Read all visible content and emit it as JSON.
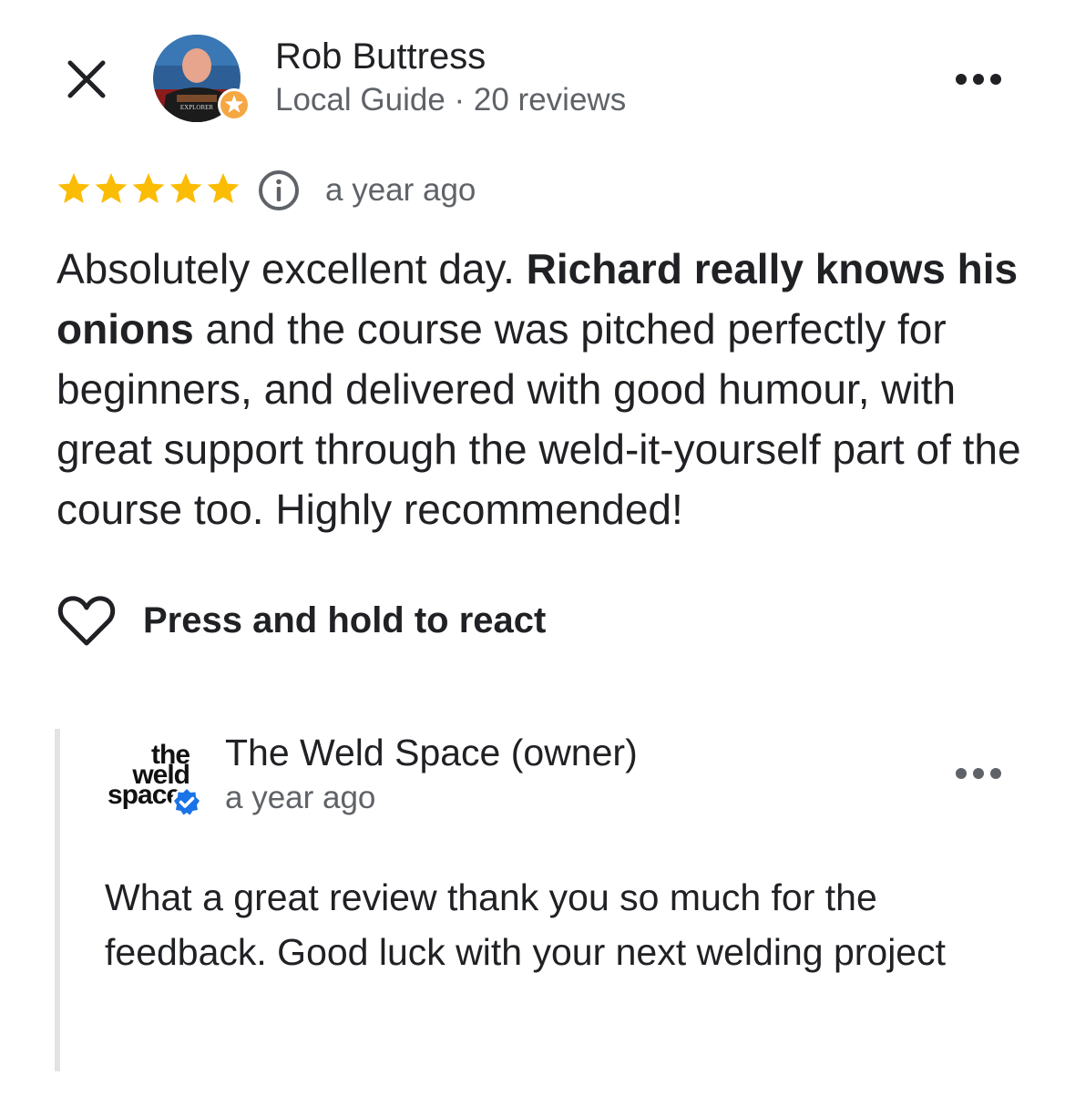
{
  "review": {
    "reviewer": {
      "name": "Rob Buttress",
      "meta": "Local Guide · 20 reviews",
      "avatar_shirt_text": "EXPLORER"
    },
    "rating": 5,
    "rating_max": 5,
    "time": "a year ago",
    "text_parts": [
      {
        "text": "Absolutely  excellent day. ",
        "bold": false
      },
      {
        "text": "Richard really knows his onions",
        "bold": true
      },
      {
        "text": " and the course was pitched perfectly for beginners, and delivered with good humour, with great support through the weld-it-yourself part of the course too. Highly recommended!",
        "bold": false
      }
    ],
    "react_label": "Press and hold to react"
  },
  "owner_reply": {
    "name": "The Weld Space (owner)",
    "time": "a year ago",
    "logo_text": [
      "the",
      "weld",
      "space"
    ],
    "text": "What a great review thank you so much for the feedback. Good luck with your next welding project"
  },
  "icons": {
    "close": "close-icon",
    "more": "more-horizontal-icon",
    "star": "star-icon",
    "info": "info-icon",
    "heart": "heart-outline-icon",
    "verified": "verified-badge-icon",
    "local_guide": "local-guide-badge-icon"
  },
  "colors": {
    "star": "#fbbc04",
    "text_primary": "#202124",
    "text_secondary": "#5f6368",
    "verified_blue": "#1a73e8",
    "reply_bar": "#e3e3e3"
  }
}
